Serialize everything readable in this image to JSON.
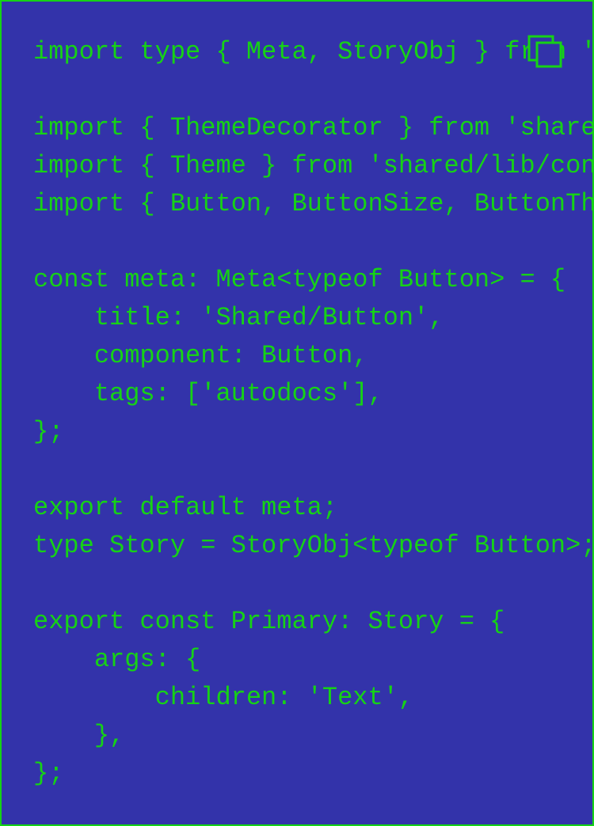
{
  "code_block": {
    "lines": [
      "import type { Meta, StoryObj } from '@storybook/react';",
      "",
      "import { ThemeDecorator } from 'shared/config/storybook/ThemeDecorator';",
      "import { Theme } from 'shared/lib/context/ThemeContext';",
      "import { Button, ButtonSize, ButtonTheme } from './Button';",
      "",
      "const meta: Meta<typeof Button> = {",
      "    title: 'Shared/Button',",
      "    component: Button,",
      "    tags: ['autodocs'],",
      "};",
      "",
      "export default meta;",
      "type Story = StoryObj<typeof Button>;",
      "",
      "export const Primary: Story = {",
      "    args: {",
      "        children: 'Text',",
      "    },",
      "};"
    ]
  },
  "copy_button": {
    "icon": "copy-icon"
  },
  "colors": {
    "background": "#3333aa",
    "text": "#16d216",
    "border": "#16d216"
  }
}
